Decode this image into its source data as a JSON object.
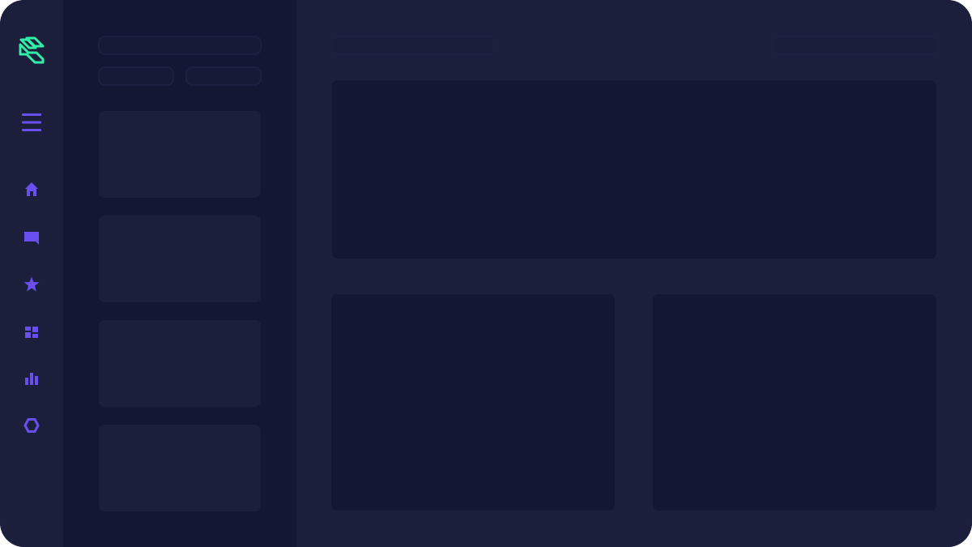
{
  "theme": {
    "background": "#1c1f3b",
    "panel": "#131733",
    "accent": "#6a4ff0",
    "logo": "#2ff0a8"
  },
  "rail": {
    "logo_icon": "s-logo-icon",
    "menu_icon": "hamburger-menu-icon",
    "nav": [
      {
        "icon": "home-icon"
      },
      {
        "icon": "chat-icon"
      },
      {
        "icon": "star-icon"
      },
      {
        "icon": "dashboard-icon"
      },
      {
        "icon": "bar-chart-icon"
      },
      {
        "icon": "hexagon-icon"
      }
    ]
  },
  "list_panel": {
    "search_placeholder": "",
    "filters": [
      "",
      ""
    ],
    "cards": [
      {},
      {},
      {},
      {}
    ]
  },
  "main": {
    "title_placeholder": "",
    "search_placeholder": "",
    "panels": [
      "top",
      "bottom-left",
      "bottom-right"
    ]
  }
}
